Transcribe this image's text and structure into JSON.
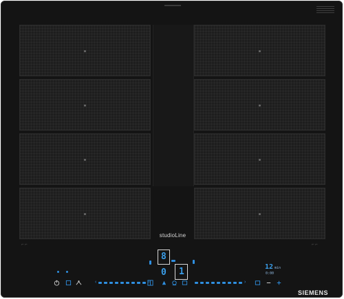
{
  "cooktop": {
    "series_label": "studioLine",
    "brand": "SIEMENS",
    "zone_count": 8
  },
  "displays": {
    "left_upper_digit": "8",
    "left_lower_digit": "0",
    "right_lower_digit": "1",
    "timer_value": "12",
    "timer_unit": "min",
    "timer_sub": "0:00"
  },
  "sliders": {
    "left_ticks": 14,
    "right_ticks": 14
  },
  "colors": {
    "glass": "#141414",
    "zone": "#1e1e1e",
    "accent": "#2f8fe0",
    "text": "#d8d8d8"
  },
  "icons": {
    "power": "power-icon",
    "wipe_protect": "wipe-protect-icon",
    "child_lock": "child-lock-icon",
    "flex": "flex-zone-icon",
    "keep_warm": "keep-warm-icon"
  }
}
